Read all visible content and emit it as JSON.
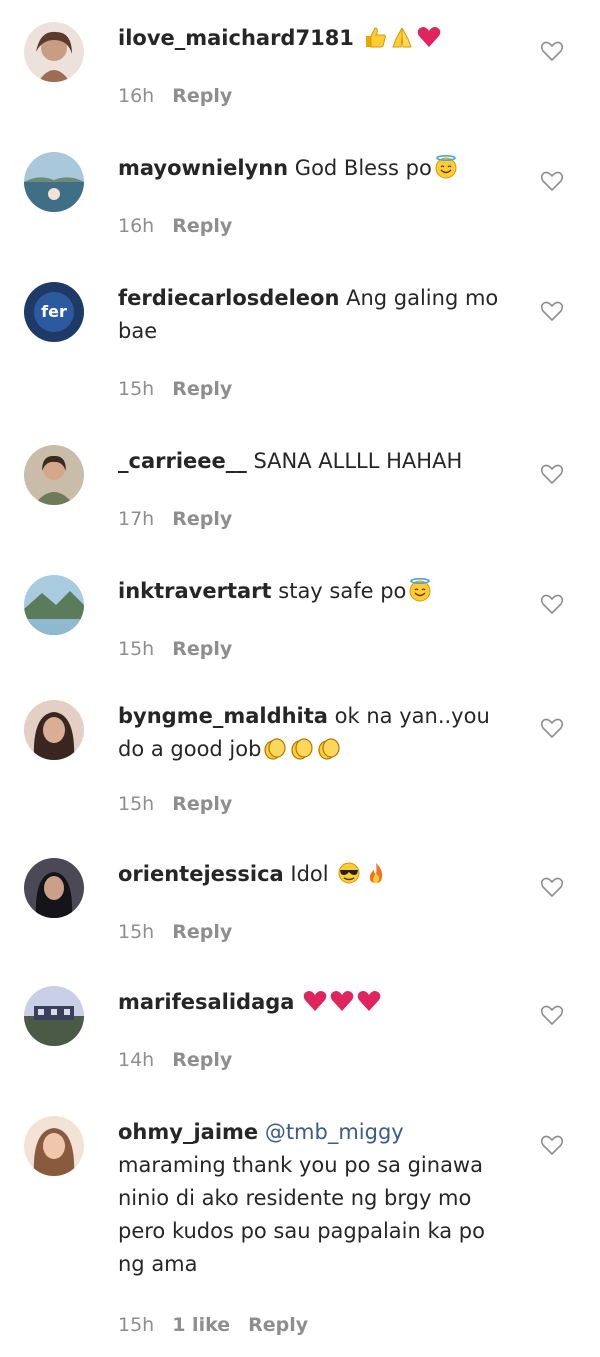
{
  "comments": [
    {
      "username": "ilove_maichard7181",
      "text": "",
      "emojis": [
        "thumbs-up-icon",
        "folded-hands-icon",
        "red-heart-icon"
      ],
      "time": "16h",
      "reply_label": "Reply",
      "avatar_colors": [
        "#e9ddd6",
        "#b98e76"
      ]
    },
    {
      "username": "mayownielynn",
      "text": "God Bless po",
      "emojis": [
        "smiling-face-halo-icon"
      ],
      "time": "16h",
      "reply_label": "Reply",
      "avatar_colors": [
        "#8fb4cc",
        "#3e6f86"
      ]
    },
    {
      "username": "ferdiecarlosdeleon",
      "text": "Ang galing mo bae",
      "emojis": [],
      "time": "15h",
      "reply_label": "Reply",
      "avatar_colors": [
        "#1e3a66",
        "#4f86c6"
      ]
    },
    {
      "username": "_carrieee__",
      "text": "SANA ALLLL HAHAH",
      "emojis": [],
      "time": "17h",
      "reply_label": "Reply",
      "avatar_colors": [
        "#c4b7a3",
        "#6e7a5a"
      ]
    },
    {
      "username": "inktravertart",
      "text": "stay safe po",
      "emojis": [
        "smiling-face-halo-icon"
      ],
      "time": "15h",
      "reply_label": "Reply",
      "avatar_colors": [
        "#9cc0d8",
        "#5b7b5a"
      ]
    },
    {
      "username": "byngme_maldhita",
      "text": "ok na yan..you do a good job",
      "emojis": [
        "clapping-hands-icon",
        "clapping-hands-icon",
        "clapping-hands-icon"
      ],
      "time": "15h",
      "reply_label": "Reply",
      "avatar_colors": [
        "#d9b7a6",
        "#3a2620"
      ]
    },
    {
      "username": "orientejessica",
      "text": "Idol",
      "emojis": [
        "smiling-face-sunglasses-icon",
        "fire-icon"
      ],
      "time": "15h",
      "reply_label": "Reply",
      "avatar_colors": [
        "#5b5a66",
        "#15141a"
      ]
    },
    {
      "username": "marifesalidaga",
      "text": "",
      "emojis": [
        "red-heart-icon",
        "red-heart-icon",
        "red-heart-icon"
      ],
      "time": "14h",
      "reply_label": "Reply",
      "avatar_colors": [
        "#c9cfe6",
        "#4a5a45"
      ]
    },
    {
      "username": "ohmy_jaime",
      "mention": "@tmb_miggy",
      "text": "maraming thank you po sa ginawa ninio di ako residente ng brgy mo pero kudos po sau pagpalain ka po ng ama",
      "emojis": [],
      "time": "15h",
      "likes_label": "1 like",
      "reply_label": "Reply",
      "avatar_colors": [
        "#f0d6c4",
        "#b07a5c"
      ]
    }
  ],
  "colors": {
    "username": "#262626",
    "meta": "#8e8e8e",
    "mention": "#3b5b8a",
    "heart_outline": "#8e8e8e",
    "emoji_yellow": "#ffcc33",
    "emoji_red": "#e0245e"
  }
}
